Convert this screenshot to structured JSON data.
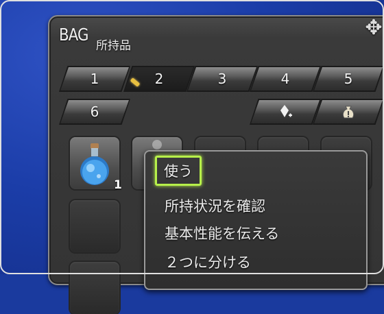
{
  "window": {
    "title": "BAG",
    "subtitle": "所持品"
  },
  "tabs": [
    "1",
    "2",
    "3",
    "4",
    "5",
    "6"
  ],
  "active_tab": "2",
  "slots": {
    "item_quantity": "1"
  },
  "context_menu": {
    "items": [
      "使う",
      "所持状況を確認",
      "基本性能を伝える",
      "２つに分ける"
    ],
    "selected": "使う"
  },
  "colors": {
    "background": "#1b3da8",
    "window": "#343434",
    "highlight": "#b7f04a"
  }
}
